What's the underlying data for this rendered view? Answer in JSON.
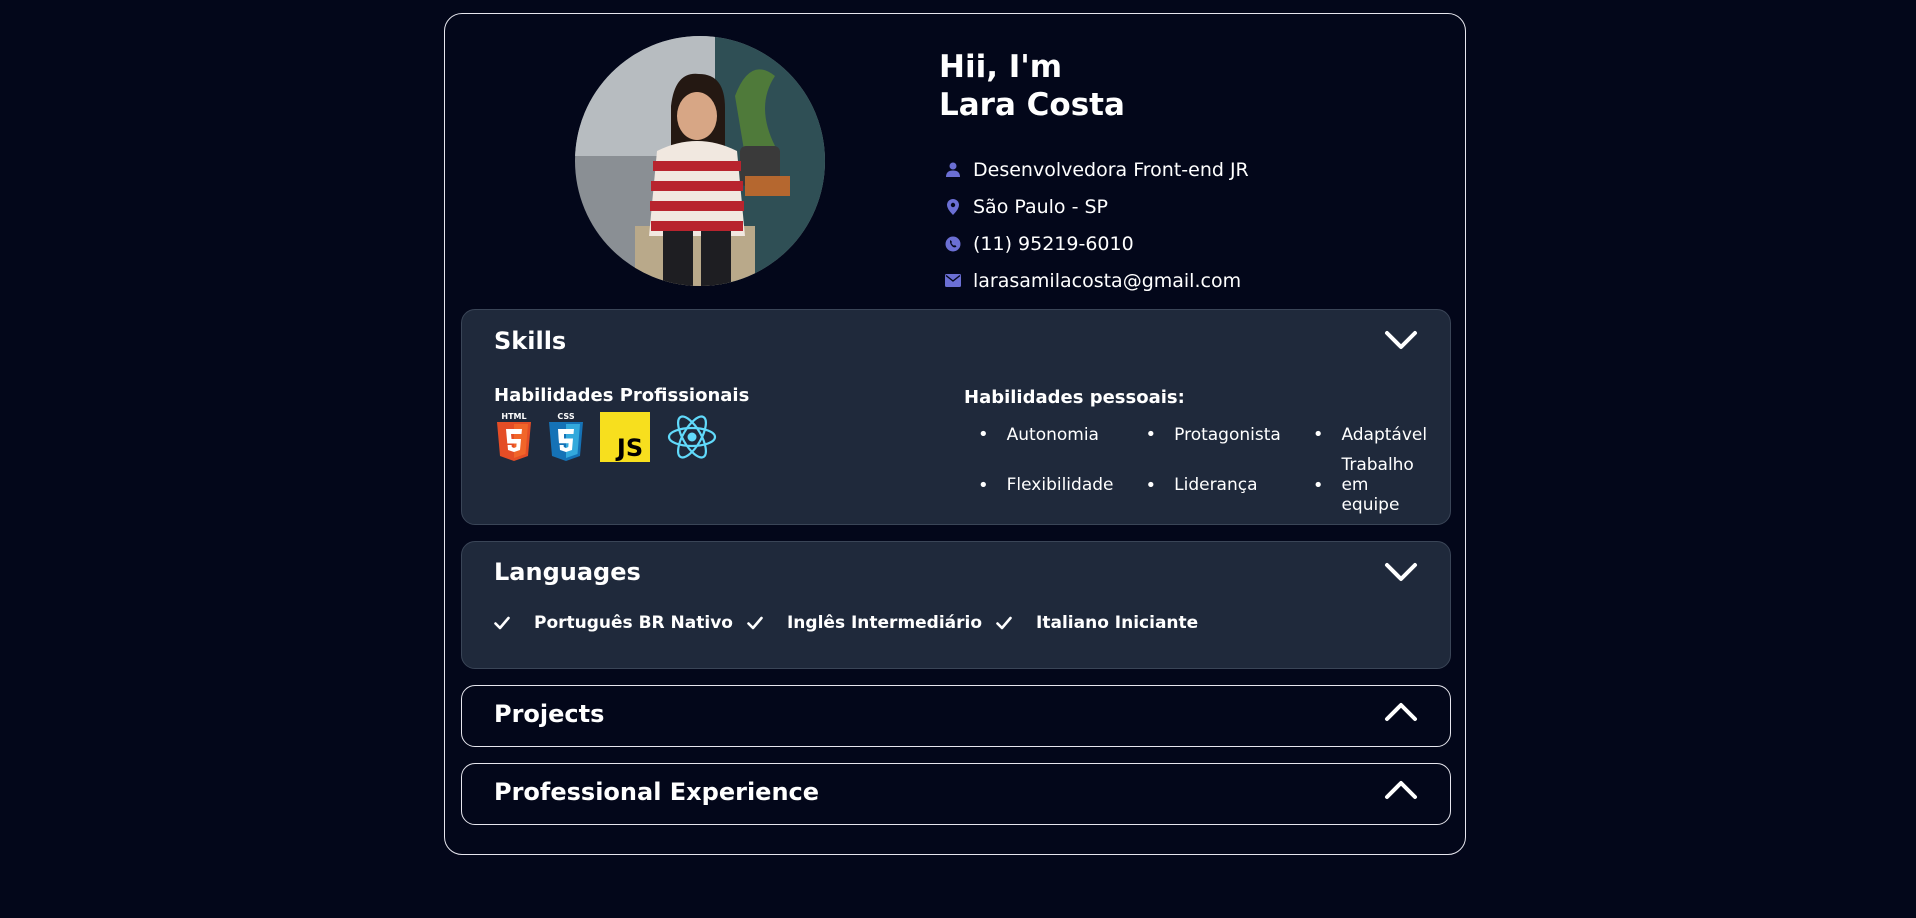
{
  "profile": {
    "greeting": "Hii, I'm",
    "name": "Lara Costa",
    "role": "Desenvolvedora Front-end JR",
    "location": "São Paulo - SP",
    "phone": "(11) 95219-6010",
    "email": "larasamilacosta@gmail.com"
  },
  "skills": {
    "title": "Skills",
    "professional_title": "Habilidades Profissionais",
    "logos": [
      "html5-icon",
      "css3-icon",
      "js-icon",
      "react-icon"
    ],
    "logo_text": {
      "html": "HTML",
      "css": "CSS",
      "js": "JS"
    },
    "personal_title": "Habilidades pessoais:",
    "personal": [
      "Autonomia",
      "Protagonista",
      "Adaptável",
      "Flexibilidade",
      "Liderança",
      "Trabalho em equipe"
    ]
  },
  "languages": {
    "title": "Languages",
    "items": [
      "Português BR Nativo",
      "Inglês Intermediário",
      "Italiano Iniciante"
    ]
  },
  "projects": {
    "title": "Projects"
  },
  "experience": {
    "title": "Professional Experience"
  },
  "colors": {
    "background": "#03071a",
    "panel": "#1f293b",
    "icon_accent": "#6b6fd4",
    "js_yellow": "#f7df1e",
    "html_orange": "#e44d26",
    "css_blue": "#2965f1",
    "react_cyan": "#61dafb"
  }
}
